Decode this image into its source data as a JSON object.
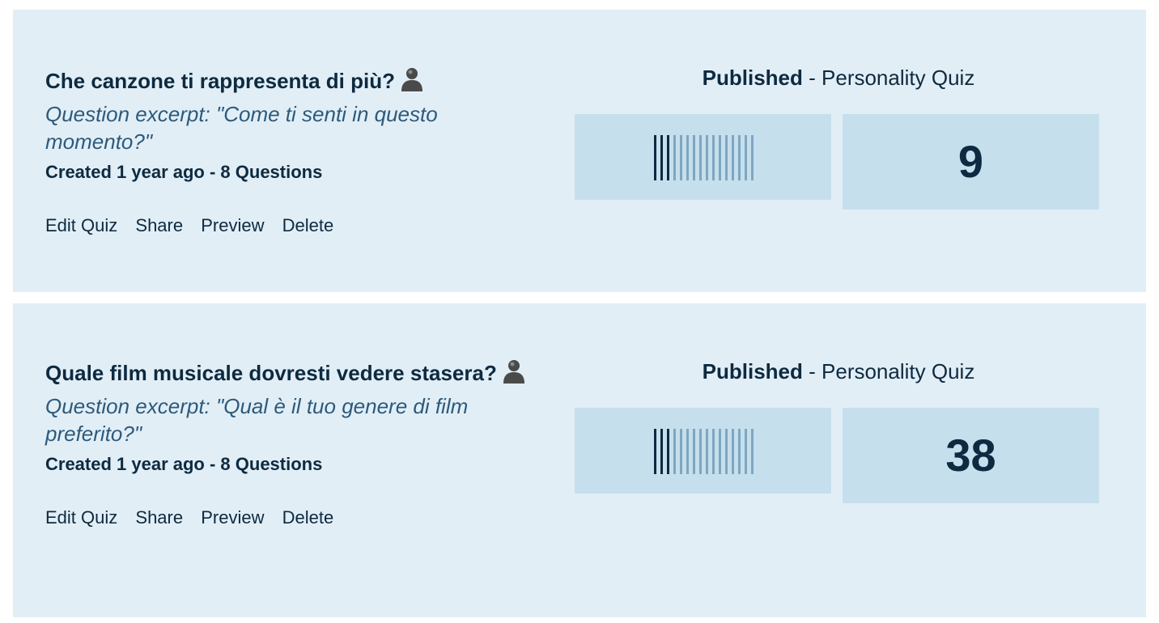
{
  "quizzes": [
    {
      "title": "Che canzone ti rappresenta di più?",
      "owner_icon": "user-silhouette-icon",
      "excerpt": "Question excerpt: \"Come ti senti in questo momento?\"",
      "meta": "Created 1 year ago - 8 Questions",
      "actions": [
        "Edit Quiz",
        "Share",
        "Preview",
        "Delete"
      ],
      "status": "Published",
      "status_separator": " - ",
      "quiz_type": "Personality Quiz",
      "activity_icon": "activity-bars-icon",
      "count": "9"
    },
    {
      "title": "Quale film musicale dovresti vedere stasera?",
      "owner_icon": "user-silhouette-icon",
      "excerpt": "Question excerpt: \"Qual è il tuo genere di film preferito?\"",
      "meta": "Created 1 year ago - 8 Questions",
      "actions": [
        "Edit Quiz",
        "Share",
        "Preview",
        "Delete"
      ],
      "status": "Published",
      "status_separator": " - ",
      "quiz_type": "Personality Quiz",
      "activity_icon": "activity-bars-icon",
      "count": "38"
    }
  ],
  "colors": {
    "card_background": "#e2eef6",
    "tile_background": "#c6dfed",
    "text_dark": "#0d2a40",
    "excerpt_text": "#2c5a7c"
  }
}
